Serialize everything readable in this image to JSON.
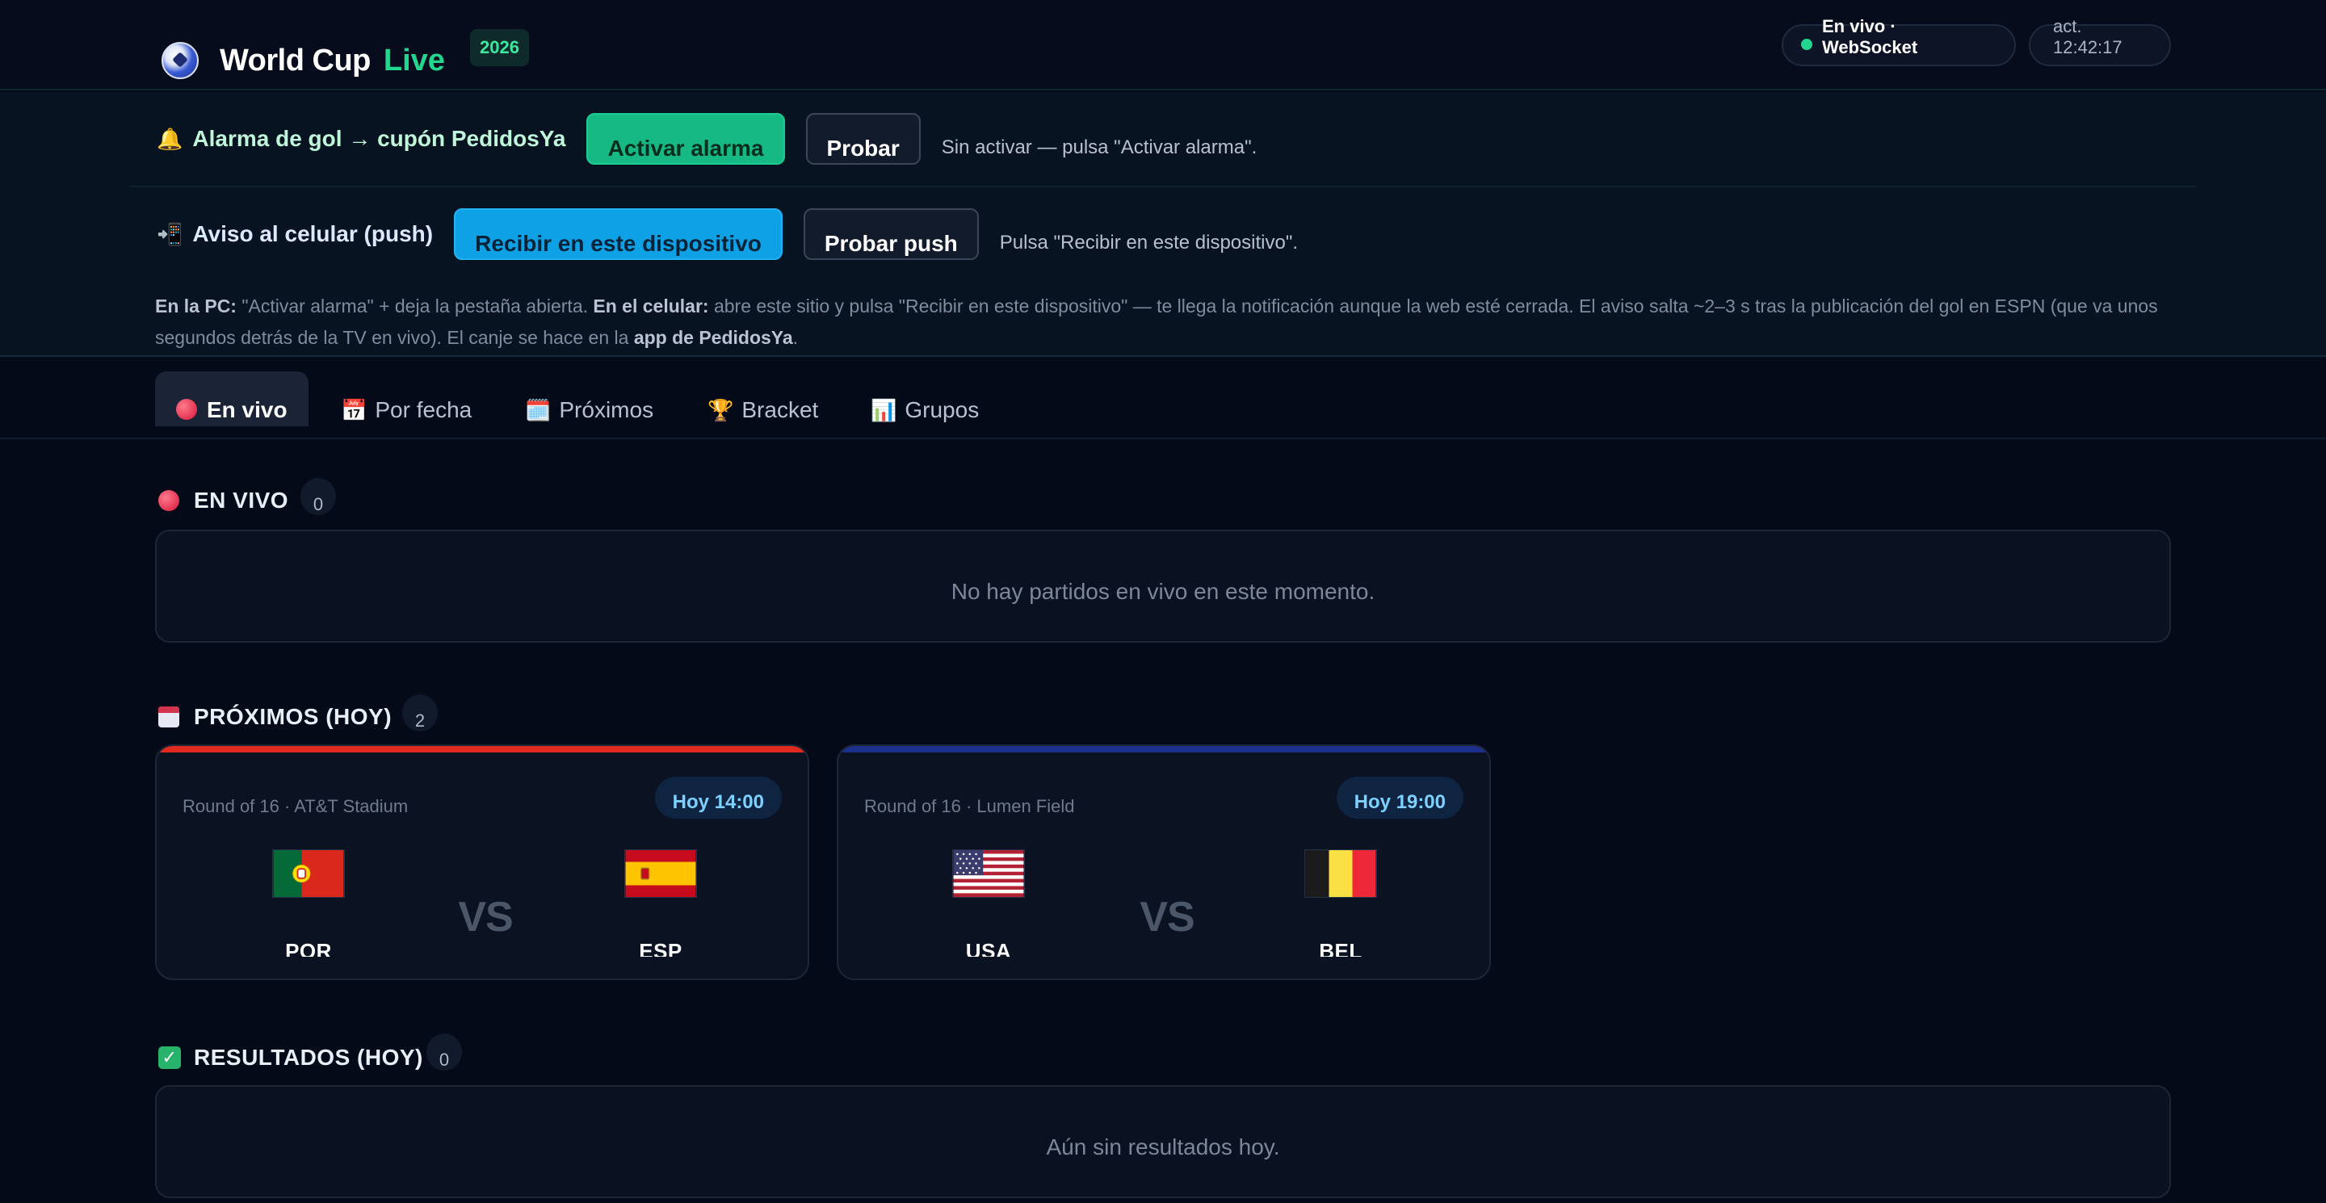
{
  "header": {
    "title": "World Cup",
    "title_live": "Live",
    "year": "2026",
    "status": "En vivo · WebSocket",
    "updated": "act. 12:42:17"
  },
  "alarm": {
    "title": "Alarma de gol → cupón PedidosYa",
    "activate_label": "Activar alarma",
    "test_label": "Probar",
    "hint": "Sin activar — pulsa \"Activar alarma\"."
  },
  "push": {
    "title": "Aviso al celular (push)",
    "receive_label": "Recibir en este dispositivo",
    "test_label": "Probar push",
    "hint": "Pulsa \"Recibir en este dispositivo\"."
  },
  "help": {
    "pc_label": "En la PC:",
    "pc_text": " \"Activar alarma\" + deja la pestaña abierta. ",
    "phone_label": "En el celular:",
    "phone_text": " abre este sitio y pulsa \"Recibir en este dispositivo\" — te llega la notificación aunque la web esté cerrada. El aviso salta ~2–3 s tras la publicación del gol en ESPN (que va unos segundos detrás de la TV en vivo). El canje se hace en la ",
    "app_label": "app de PedidosYa",
    "end": "."
  },
  "tabs": [
    {
      "label": "En vivo",
      "icon": "red-circle-icon"
    },
    {
      "label": "Por fecha",
      "icon": "calendar-icon"
    },
    {
      "label": "Próximos",
      "icon": "calendar-spiral-icon"
    },
    {
      "label": "Bracket",
      "icon": "trophy-icon"
    },
    {
      "label": "Grupos",
      "icon": "bar-chart-icon"
    }
  ],
  "sections": {
    "live": {
      "title": "EN VIVO",
      "count": "0",
      "empty": "No hay partidos en vivo en este momento."
    },
    "upcoming": {
      "title": "PRÓXIMOS (HOY)",
      "count": "2"
    },
    "results": {
      "title": "RESULTADOS (HOY)",
      "count": "0",
      "empty": "Aún sin resultados hoy."
    }
  },
  "matches": [
    {
      "meta": "Round of 16 · AT&T Stadium",
      "time": "Hoy 14:00",
      "home": "POR",
      "away": "ESP",
      "vs": "VS",
      "accent": "#e0291f"
    },
    {
      "meta": "Round of 16 · Lumen Field",
      "time": "Hoy 19:00",
      "home": "USA",
      "away": "BEL",
      "vs": "VS",
      "accent": "#1c2f8a"
    }
  ],
  "colors": {
    "background": "#050a18",
    "accent_green": "#22d68f",
    "button_green": "#16b883",
    "button_blue": "#0ea1e6"
  }
}
